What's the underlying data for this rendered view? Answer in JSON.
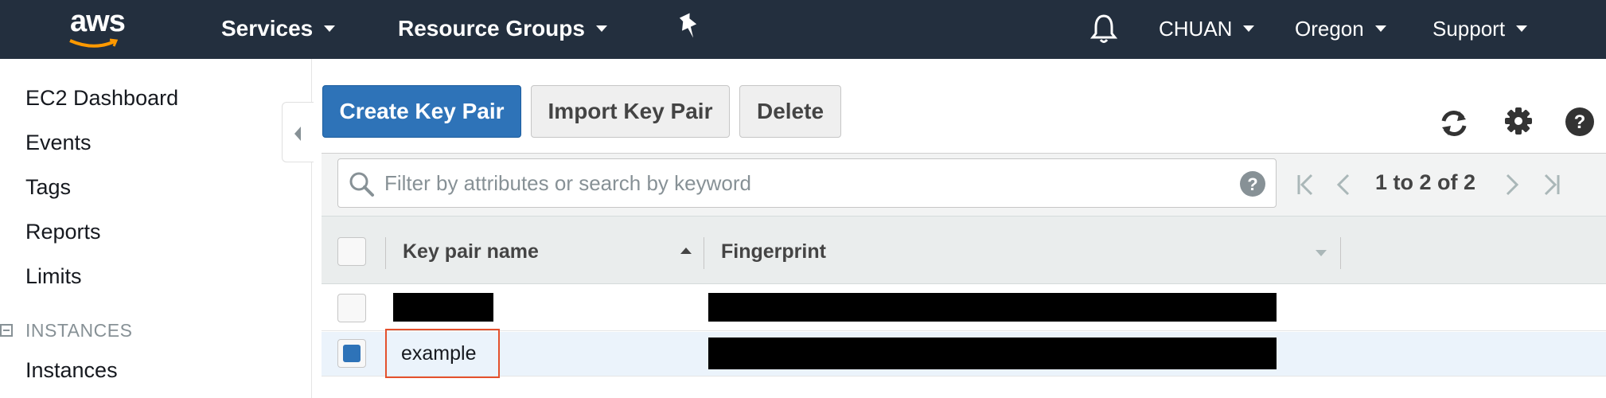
{
  "nav": {
    "logo": "aws",
    "services": "Services",
    "resource_groups": "Resource Groups",
    "account": "CHUAN",
    "region": "Oregon",
    "support": "Support",
    "pin_icon": "pin-icon",
    "bell_icon": "bell-icon"
  },
  "sidebar": {
    "items": [
      "EC2 Dashboard",
      "Events",
      "Tags",
      "Reports",
      "Limits"
    ],
    "section": "INSTANCES",
    "section_items": [
      "Instances"
    ]
  },
  "toolbar": {
    "create": "Create Key Pair",
    "import": "Import Key Pair",
    "delete": "Delete",
    "icons": [
      "refresh-icon",
      "gear-icon",
      "help-icon"
    ]
  },
  "filter": {
    "placeholder": "Filter by attributes or search by keyword",
    "value": "",
    "pager": "1 to 2 of 2"
  },
  "table": {
    "columns": [
      "Key pair name",
      "Fingerprint"
    ],
    "rows": [
      {
        "name": "",
        "fingerprint": "",
        "selected": false,
        "redacted": true
      },
      {
        "name": "example",
        "fingerprint": "",
        "selected": true,
        "redacted": false
      }
    ]
  },
  "colors": {
    "nav_bg": "#232f3e",
    "primary": "#2e73b8",
    "highlight": "#e4512d",
    "logo_smile": "#ff9900"
  }
}
